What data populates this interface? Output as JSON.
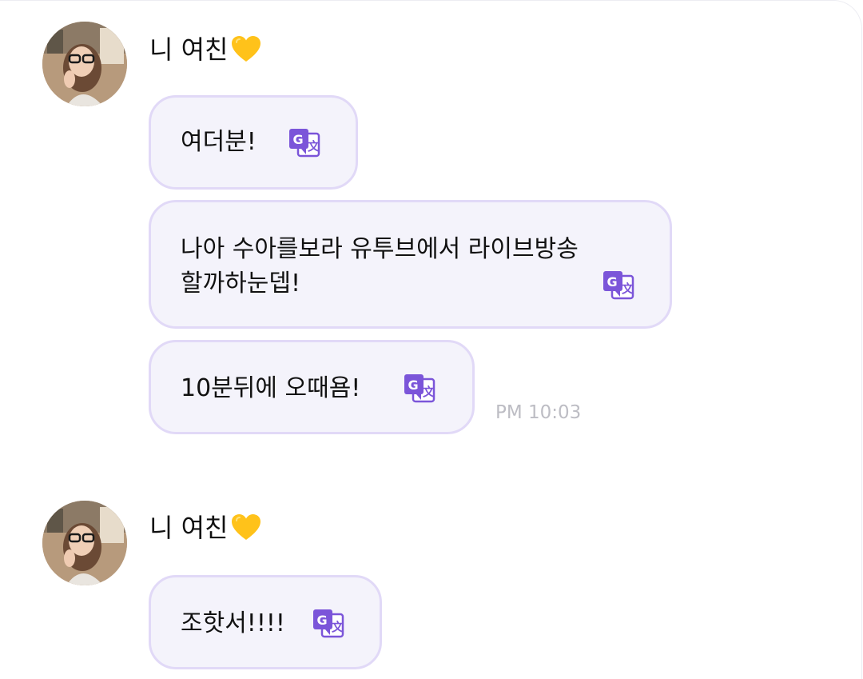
{
  "colors": {
    "bubble_bg": "#f4f3fb",
    "bubble_border": "#e1d9f7",
    "translate_icon": "#7b55d9",
    "timestamp": "#bdbdc4",
    "heart": "#ffc21a"
  },
  "groups": [
    {
      "sender": "니 여친",
      "sender_icon": "yellow-heart-icon",
      "avatar": "profile-avatar",
      "messages": [
        {
          "text": "여더분!",
          "icon": "translate-icon"
        },
        {
          "text": "나아 수아를보라 유투브에서 라이브방송\n할까하눈뎁!",
          "icon": "translate-icon"
        },
        {
          "text": "10분뒤에 오때욤!",
          "icon": "translate-icon"
        }
      ],
      "timestamp": "PM 10:03"
    },
    {
      "sender": "니 여친",
      "sender_icon": "yellow-heart-icon",
      "avatar": "profile-avatar",
      "messages": [
        {
          "text": "조핫서!!!!",
          "icon": "translate-icon"
        }
      ]
    }
  ]
}
